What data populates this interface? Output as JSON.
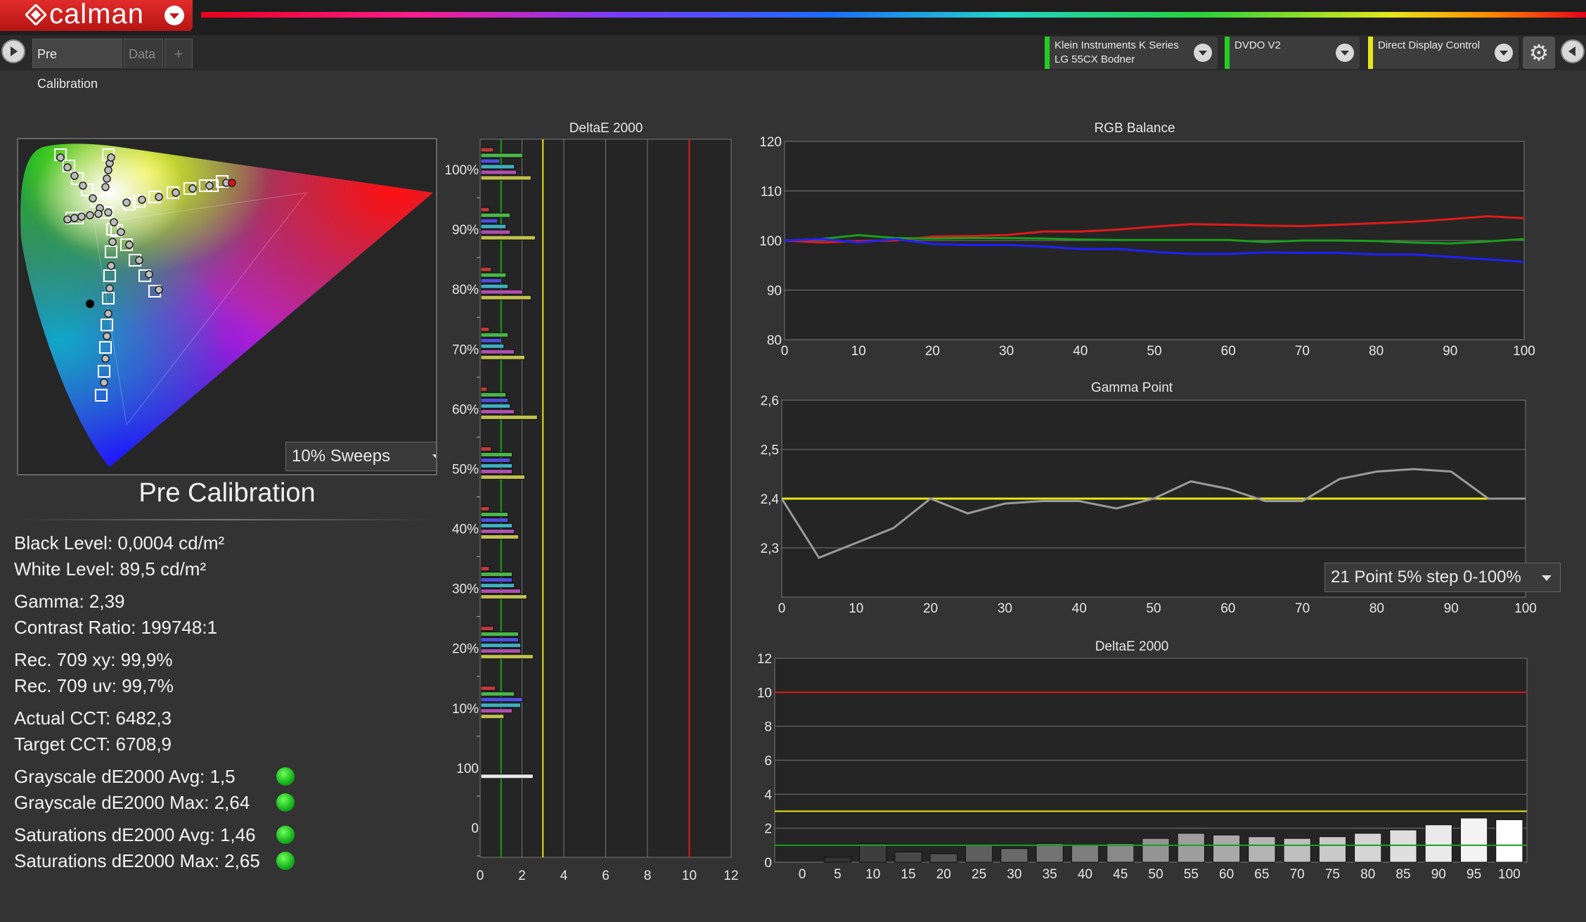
{
  "app": {
    "logo_text": "calman"
  },
  "tabs": [
    {
      "label": "Pre Calibration",
      "active": true
    },
    {
      "label": "Data",
      "active": false
    },
    {
      "label": "+",
      "active": false
    }
  ],
  "devices": [
    {
      "line1": "Klein Instruments K Series",
      "line2": "LG 55CX Bodner",
      "color": "#22cc22"
    },
    {
      "line1": "DVDO V2",
      "line2": "",
      "color": "#22cc22"
    },
    {
      "line1": "Direct Display Control",
      "line2": "",
      "color": "#e6e61a"
    }
  ],
  "cie": {
    "sweep_select": "10% Sweeps"
  },
  "page_title": "Pre Calibration",
  "stats": [
    {
      "text": "Black Level: 0,0004 cd/m²",
      "indicator": false
    },
    {
      "text": "White Level: 89,5 cd/m²",
      "indicator": false
    },
    {
      "text": "Gamma: 2,39",
      "indicator": false
    },
    {
      "text": "Contrast Ratio: 199748:1",
      "indicator": false
    },
    {
      "text": "Rec. 709 xy: 99,9%",
      "indicator": false
    },
    {
      "text": "Rec. 709 uv: 99,7%",
      "indicator": false
    },
    {
      "text": "Actual CCT: 6482,3",
      "indicator": false
    },
    {
      "text": "Target CCT: 6708,9",
      "indicator": false
    },
    {
      "text": "Grayscale dE2000 Avg: 1,5",
      "indicator": true
    },
    {
      "text": "Grayscale dE2000 Max: 2,64",
      "indicator": true
    },
    {
      "text": "Saturations dE2000 Avg: 1,46",
      "indicator": true
    },
    {
      "text": "Saturations dE2000 Max: 2,65",
      "indicator": true
    }
  ],
  "chart_data": [
    {
      "type": "bar",
      "orientation": "horizontal",
      "title": "DeltaE 2000",
      "categories": [
        "100%",
        "90%",
        "80%",
        "70%",
        "60%",
        "50%",
        "40%",
        "30%",
        "20%",
        "10%",
        "100",
        "0"
      ],
      "series_colors": [
        "#c03a3a",
        "#4ab84a",
        "#5050e0",
        "#40b0c0",
        "#b050b0",
        "#c0c050"
      ],
      "values": [
        [
          0.6,
          2.0,
          0.9,
          1.6,
          1.7,
          2.4
        ],
        [
          0.4,
          1.4,
          0.8,
          1.2,
          1.4,
          2.6
        ],
        [
          0.5,
          1.2,
          1.0,
          1.3,
          2.0,
          2.4
        ],
        [
          0.4,
          1.3,
          1.0,
          1.1,
          1.6,
          2.1
        ],
        [
          0.3,
          1.2,
          1.3,
          1.4,
          1.6,
          2.7
        ],
        [
          0.5,
          1.5,
          1.4,
          1.5,
          1.5,
          2.1
        ],
        [
          0.4,
          1.3,
          1.3,
          1.5,
          1.6,
          1.8
        ],
        [
          0.4,
          1.5,
          1.5,
          1.6,
          1.9,
          2.2
        ],
        [
          0.6,
          1.8,
          1.8,
          1.9,
          1.9,
          2.5
        ],
        [
          0.7,
          1.6,
          2.0,
          1.9,
          1.5,
          1.1
        ],
        [
          0,
          0,
          0,
          0,
          0,
          2.5
        ],
        [
          0,
          0,
          0,
          0,
          0,
          0
        ]
      ],
      "xlim": [
        0,
        12
      ],
      "x_ticks": [
        0,
        2,
        4,
        6,
        8,
        10,
        12
      ],
      "reference_lines": [
        {
          "value": 1,
          "color": "#1aa01a"
        },
        {
          "value": 3,
          "color": "#e6e61a"
        },
        {
          "value": 10,
          "color": "#e01a1a"
        }
      ]
    },
    {
      "type": "line",
      "title": "RGB Balance",
      "x": [
        0,
        5,
        10,
        15,
        20,
        25,
        30,
        35,
        40,
        45,
        50,
        55,
        60,
        65,
        70,
        75,
        80,
        85,
        90,
        95,
        100
      ],
      "series": [
        {
          "color": "#e01a1a",
          "values": [
            100,
            99.6,
            99.9,
            100.0,
            100.8,
            100.9,
            101.1,
            101.8,
            101.8,
            102.2,
            102.8,
            103.3,
            103.2,
            103.0,
            102.9,
            103.2,
            103.5,
            103.8,
            104.3,
            104.9,
            104.5
          ]
        },
        {
          "color": "#1aa01a",
          "values": [
            100,
            100.3,
            101.1,
            100.5,
            100.4,
            100.5,
            100.5,
            100.4,
            100.2,
            100.1,
            100.1,
            100.1,
            100.1,
            99.7,
            100.0,
            100.0,
            99.9,
            99.6,
            99.4,
            99.8,
            100.3
          ]
        },
        {
          "color": "#2020ff",
          "values": [
            100,
            100.3,
            99.6,
            100.3,
            99.3,
            99.1,
            99.1,
            98.8,
            98.3,
            98.3,
            97.7,
            97.3,
            97.3,
            97.6,
            97.5,
            97.5,
            97.2,
            97.2,
            96.7,
            96.2,
            95.7
          ]
        }
      ],
      "ylim": [
        80,
        120
      ],
      "y_ticks": [
        80,
        90,
        100,
        110,
        120
      ],
      "x_ticks": [
        0,
        10,
        20,
        30,
        40,
        50,
        60,
        70,
        80,
        90,
        100
      ]
    },
    {
      "type": "line",
      "title": "Gamma Point",
      "x": [
        0,
        5,
        10,
        15,
        20,
        25,
        30,
        35,
        40,
        45,
        50,
        55,
        60,
        65,
        70,
        75,
        80,
        85,
        90,
        95,
        100
      ],
      "series": [
        {
          "color": "#9a9a9a",
          "values": [
            2.4,
            2.28,
            2.31,
            2.34,
            2.4,
            2.37,
            2.39,
            2.395,
            2.395,
            2.38,
            2.4,
            2.435,
            2.42,
            2.395,
            2.395,
            2.44,
            2.455,
            2.46,
            2.455,
            2.4,
            2.4
          ]
        }
      ],
      "reference_lines": [
        {
          "value": 2.4,
          "color": "#e6e61a"
        }
      ],
      "ylim": [
        2.2,
        2.6
      ],
      "y_ticks": [
        2.3,
        2.4,
        2.5,
        2.6
      ],
      "y_tick_labels": [
        "2,3",
        "2,4",
        "2,5",
        "2,6"
      ],
      "x_ticks": [
        0,
        10,
        20,
        30,
        40,
        50,
        60,
        70,
        80,
        90,
        100
      ],
      "select": "21 Point 5% step 0-100%"
    },
    {
      "type": "bar",
      "title": "DeltaE 2000",
      "categories": [
        "0",
        "5",
        "10",
        "15",
        "20",
        "25",
        "30",
        "35",
        "40",
        "45",
        "50",
        "55",
        "60",
        "65",
        "70",
        "75",
        "80",
        "85",
        "90",
        "95",
        "100"
      ],
      "values": [
        0,
        0.3,
        1.1,
        0.6,
        0.5,
        1.0,
        0.8,
        1.1,
        1.0,
        1.1,
        1.4,
        1.7,
        1.6,
        1.5,
        1.4,
        1.5,
        1.7,
        1.9,
        2.2,
        2.6,
        2.5
      ],
      "reference_lines": [
        {
          "value": 1,
          "color": "#1aa01a"
        },
        {
          "value": 3,
          "color": "#e6e61a"
        },
        {
          "value": 10,
          "color": "#e01a1a"
        }
      ],
      "ylim": [
        0,
        12
      ],
      "y_ticks": [
        0,
        2,
        4,
        6,
        8,
        10,
        12
      ]
    }
  ]
}
